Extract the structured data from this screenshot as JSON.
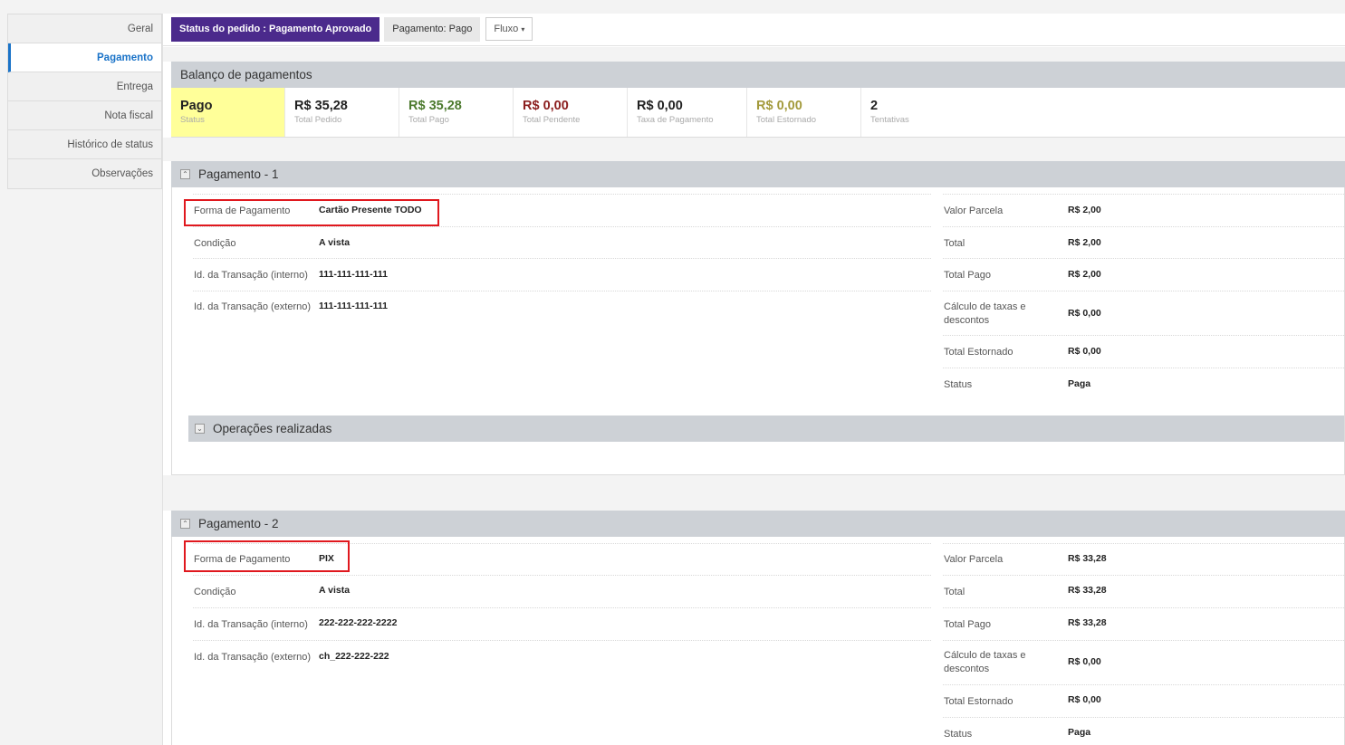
{
  "sidebar": {
    "items": [
      {
        "label": "Geral"
      },
      {
        "label": "Pagamento"
      },
      {
        "label": "Entrega"
      },
      {
        "label": "Nota fiscal"
      },
      {
        "label": "Histórico de status"
      },
      {
        "label": "Observações"
      }
    ]
  },
  "toolbar": {
    "status_label": "Status do pedido : Pagamento Aprovado",
    "payment_label": "Pagamento: Pago",
    "flow_label": "Fluxo",
    "flow_caret": "▾"
  },
  "balance": {
    "title": "Balanço de pagamentos",
    "status": {
      "value": "Pago",
      "label": "Status"
    },
    "total_pedido": {
      "value": "R$ 35,28",
      "label": "Total Pedido"
    },
    "total_pago": {
      "value": "R$ 35,28",
      "label": "Total Pago"
    },
    "total_pendente": {
      "value": "R$ 0,00",
      "label": "Total Pendente"
    },
    "taxa": {
      "value": "R$ 0,00",
      "label": "Taxa de Pagamento"
    },
    "estornado": {
      "value": "R$ 0,00",
      "label": "Total Estornado"
    },
    "tentativas": {
      "value": "2",
      "label": "Tentativas"
    }
  },
  "payments": [
    {
      "title": "Pagamento - 1",
      "forma": {
        "label": "Forma de Pagamento",
        "value": "Cartão Presente TODO"
      },
      "condicao": {
        "label": "Condição",
        "value": "A vista"
      },
      "id_interno": {
        "label": "Id. da Transação (interno)",
        "value": "111-111-111-111"
      },
      "id_externo": {
        "label": "Id. da Transação (externo)",
        "value": "111-111-111-111"
      },
      "valor_parcela": {
        "label": "Valor Parcela",
        "value": "R$ 2,00"
      },
      "total": {
        "label": "Total",
        "value": "R$ 2,00"
      },
      "total_pago": {
        "label": "Total Pago",
        "value": "R$ 2,00"
      },
      "calculo": {
        "label": "Cálculo de taxas e descontos",
        "value": "R$ 0,00"
      },
      "estornado": {
        "label": "Total Estornado",
        "value": "R$ 0,00"
      },
      "status": {
        "label": "Status",
        "value": "Paga"
      },
      "operations_title": "Operações realizadas"
    },
    {
      "title": "Pagamento - 2",
      "forma": {
        "label": "Forma de Pagamento",
        "value": "PIX"
      },
      "condicao": {
        "label": "Condição",
        "value": "A vista"
      },
      "id_interno": {
        "label": "Id. da Transação (interno)",
        "value": "222-222-222-2222"
      },
      "id_externo": {
        "label": "Id. da Transação (externo)",
        "value": "ch_222-222-222"
      },
      "valor_parcela": {
        "label": "Valor Parcela",
        "value": "R$ 33,28"
      },
      "total": {
        "label": "Total",
        "value": "R$ 33,28"
      },
      "total_pago": {
        "label": "Total Pago",
        "value": "R$ 33,28"
      },
      "calculo": {
        "label": "Cálculo de taxas e descontos",
        "value": "R$ 0,00"
      },
      "estornado": {
        "label": "Total Estornado",
        "value": "R$ 0,00"
      },
      "status": {
        "label": "Status",
        "value": "Paga"
      }
    }
  ],
  "colors": {
    "status_button": "#4b2a8c",
    "active_tab": "#1a73c8",
    "status_highlight": "#ffff99",
    "green_value": "#4c7a2e",
    "red_value": "#8b1e1e",
    "olive_value": "#a39a3c",
    "highlight_box": "#e0181e"
  },
  "icons": {
    "collapse": "chevron-double-up-icon",
    "expand": "chevron-double-down-icon"
  }
}
